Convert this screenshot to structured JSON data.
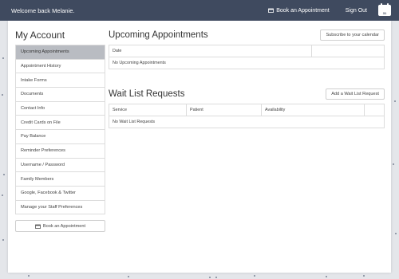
{
  "header": {
    "welcome": "Welcome back Melanie.",
    "book_label": "Book an Appointment",
    "signout_label": "Sign Out",
    "logo_icon": "calendar-logo-icon"
  },
  "sidebar": {
    "title": "My Account",
    "items": [
      {
        "label": "Upcoming Appointments",
        "active": true
      },
      {
        "label": "Appointment History"
      },
      {
        "label": "Intake Forms"
      },
      {
        "label": "Documents"
      },
      {
        "label": "Contact Info"
      },
      {
        "label": "Credit Cards on File"
      },
      {
        "label": "Pay Balance"
      },
      {
        "label": "Reminder Preferences"
      },
      {
        "label": "Username / Password"
      },
      {
        "label": "Family Members"
      },
      {
        "label": "Google, Facebook & Twitter"
      },
      {
        "label": "Manage your Staff Preferences"
      }
    ],
    "book_button": "Book an Appointment"
  },
  "upcoming": {
    "title": "Upcoming Appointments",
    "subscribe_button": "Subscribe to your calendar",
    "columns": [
      "Date",
      ""
    ],
    "empty": "No Upcoming Appointments"
  },
  "waitlist": {
    "title": "Wait List Requests",
    "add_button": "Add a Wait List Request",
    "columns": [
      "Service",
      "Patient",
      "Availability",
      ""
    ],
    "empty": "No Wait List Requests"
  },
  "colors": {
    "topbar": "#3f4a5f",
    "active_item": "#b9bcc2",
    "background": "#e4e6ea"
  }
}
